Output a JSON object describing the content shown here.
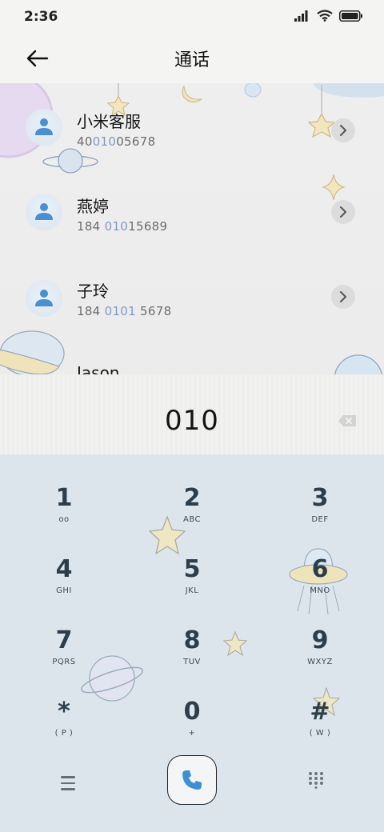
{
  "status_bar": {
    "time": "2:36"
  },
  "header": {
    "title": "通话"
  },
  "contacts": [
    {
      "name": "小米客服",
      "number_parts": [
        "40",
        "010",
        "05678"
      ]
    },
    {
      "name": "燕婷",
      "number_parts": [
        "184 ",
        "010",
        "15689"
      ]
    },
    {
      "name": "子玲",
      "number_parts": [
        "184 ",
        "0101",
        " 5678"
      ]
    },
    {
      "name": "Jason"
    }
  ],
  "dialer": {
    "input_value": "010"
  },
  "keypad": [
    {
      "digit": "1",
      "sub": "oo"
    },
    {
      "digit": "2",
      "sub": "ABC"
    },
    {
      "digit": "3",
      "sub": "DEF"
    },
    {
      "digit": "4",
      "sub": "GHI"
    },
    {
      "digit": "5",
      "sub": "JKL"
    },
    {
      "digit": "6",
      "sub": "MNO"
    },
    {
      "digit": "7",
      "sub": "PQRS"
    },
    {
      "digit": "8",
      "sub": "TUV"
    },
    {
      "digit": "9",
      "sub": "WXYZ"
    },
    {
      "digit": "*",
      "sub": "( P )"
    },
    {
      "digit": "0",
      "sub": "+"
    },
    {
      "digit": "#",
      "sub": "( W )"
    }
  ],
  "colors": {
    "accent_number": "#7f9ac7",
    "call_icon": "#3f8fd6",
    "keypad_bg": "#dde5ec"
  },
  "icons": [
    "signal-icon",
    "wifi-icon",
    "battery-icon",
    "back-arrow-icon",
    "person-icon",
    "chevron-right-icon",
    "backspace-icon",
    "menu-icon",
    "phone-icon",
    "dialpad-icon"
  ]
}
